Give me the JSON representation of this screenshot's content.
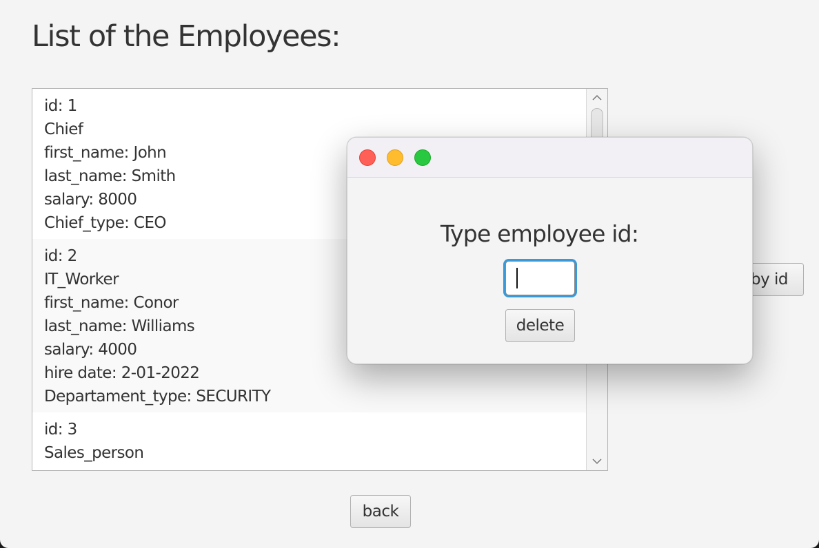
{
  "page_title": "List of the Employees:",
  "employees": [
    {
      "lines": [
        "id: 1",
        "Chief",
        "first_name: John",
        "last_name: Smith",
        "salary: 8000",
        "Chief_type: CEO"
      ]
    },
    {
      "lines": [
        "id: 2",
        "IT_Worker",
        "first_name: Conor",
        "last_name: Williams",
        "salary: 4000",
        "hire date: 2-01-2022",
        "Departament_type: SECURITY"
      ]
    },
    {
      "lines": [
        "id: 3",
        "Sales_person"
      ]
    }
  ],
  "buttons": {
    "delete_by_id_visible": "e by id",
    "back": "back"
  },
  "dialog": {
    "label": "Type employee id:",
    "input_value": "",
    "delete_button": "delete"
  },
  "colors": {
    "traffic_close": "#fe5f57",
    "traffic_minimize": "#febc2e",
    "traffic_zoom": "#28c840",
    "focus_ring": "#3a9ad9"
  }
}
